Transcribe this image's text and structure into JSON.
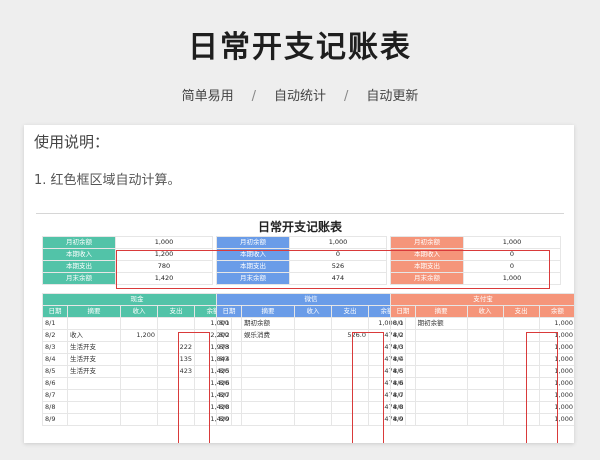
{
  "page": {
    "title": "日常开支记账表",
    "tags": [
      "简单易用",
      "自动统计",
      "自动更新"
    ],
    "separator": "/"
  },
  "card": {
    "heading": "使用说明：",
    "note": "1. 红色框区域自动计算。"
  },
  "sheet": {
    "title": "日常开支记账表",
    "colors": {
      "cash": "#52c3a8",
      "wechat": "#6a9ce8",
      "alipay": "#f5957a",
      "red": "#d93a3a"
    },
    "summary_labels": [
      "月初余额",
      "本期收入",
      "本期支出",
      "月末余额"
    ],
    "cash_summary": [
      "1,000",
      "1,200",
      "780",
      "1,420"
    ],
    "wechat_summary": [
      "1,000",
      "0",
      "526",
      "474"
    ],
    "alipay_summary": [
      "1,000",
      "0",
      "0",
      "1,000"
    ],
    "sections": {
      "cash": "现金",
      "wechat": "微信",
      "alipay": "支付宝"
    },
    "col_headers": [
      "日期",
      "摘要",
      "收入",
      "支出",
      "余额"
    ],
    "cash_rows": [
      [
        "8/1",
        "",
        "",
        "",
        "1,000"
      ],
      [
        "8/2",
        "收入",
        "1,200",
        "",
        "2,200"
      ],
      [
        "8/3",
        "生活开支",
        "",
        "222",
        "1,978"
      ],
      [
        "8/4",
        "生活开支",
        "",
        "135",
        "1,843"
      ],
      [
        "8/5",
        "生活开支",
        "",
        "423",
        "1,420"
      ],
      [
        "8/6",
        "",
        "",
        "",
        "1,420"
      ],
      [
        "8/7",
        "",
        "",
        "",
        "1,420"
      ],
      [
        "8/8",
        "",
        "",
        "",
        "1,420"
      ],
      [
        "8/9",
        "",
        "",
        "",
        "1,420"
      ]
    ],
    "wechat_rows": [
      [
        "8/1",
        "期初余额",
        "",
        "",
        "1,000.0"
      ],
      [
        "8/2",
        "娱乐消费",
        "",
        "526.0",
        "474.0"
      ],
      [
        "8/3",
        "",
        "",
        "",
        "474.0"
      ],
      [
        "8/4",
        "",
        "",
        "",
        "474.0"
      ],
      [
        "8/5",
        "",
        "",
        "",
        "474.0"
      ],
      [
        "8/6",
        "",
        "",
        "",
        "474.0"
      ],
      [
        "8/7",
        "",
        "",
        "",
        "474.0"
      ],
      [
        "8/8",
        "",
        "",
        "",
        "474.0"
      ],
      [
        "8/9",
        "",
        "",
        "",
        "474.0"
      ]
    ],
    "alipay_rows": [
      [
        "8/1",
        "期初余额",
        "",
        "",
        "1,000"
      ],
      [
        "8/2",
        "",
        "",
        "",
        "1,000"
      ],
      [
        "8/3",
        "",
        "",
        "",
        "1,000"
      ],
      [
        "8/4",
        "",
        "",
        "",
        "1,000"
      ],
      [
        "8/5",
        "",
        "",
        "",
        "1,000"
      ],
      [
        "8/6",
        "",
        "",
        "",
        "1,000"
      ],
      [
        "8/7",
        "",
        "",
        "",
        "1,000"
      ],
      [
        "8/8",
        "",
        "",
        "",
        "1,000"
      ],
      [
        "8/9",
        "",
        "",
        "",
        "1,000"
      ]
    ]
  }
}
